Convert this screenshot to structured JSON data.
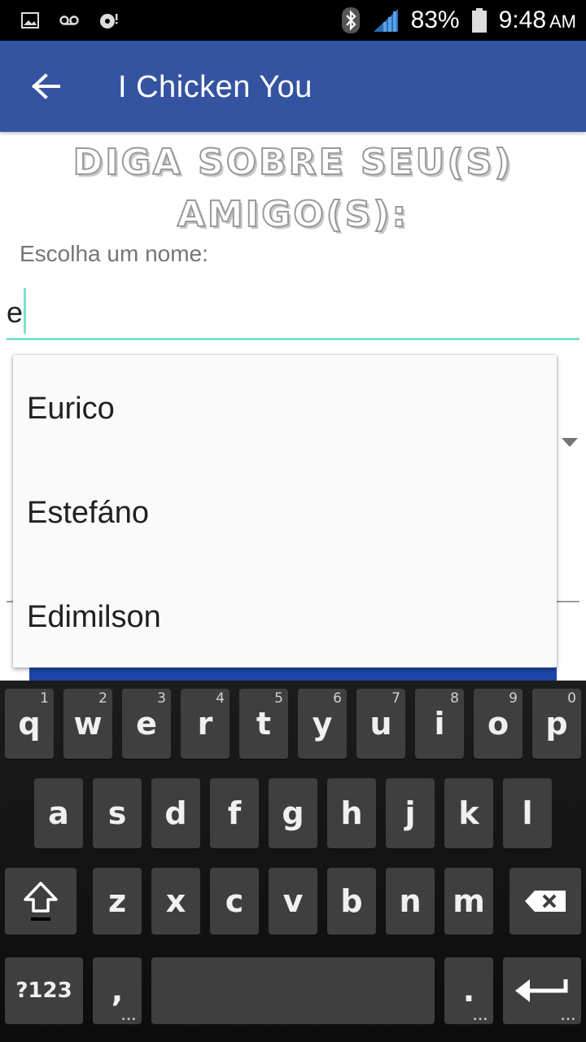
{
  "status_bar": {
    "battery": "83%",
    "time": "9:48",
    "time_suffix": "AM",
    "icons": [
      "image-icon",
      "voicemail-icon",
      "media-icon",
      "bluetooth-icon",
      "signal-icon",
      "battery-icon"
    ]
  },
  "app_bar": {
    "title": "I Chicken You",
    "back_icon": "arrow-left-icon",
    "color": "#3454a2"
  },
  "form": {
    "heading": "Diga sobre seu(s) amigo(s):",
    "name_label": "Escolha um nome:",
    "name_value": "e",
    "accent_color": "#80e0cf"
  },
  "suggestions": [
    "Eurico",
    "Estefáno",
    "Edimilson"
  ],
  "keyboard": {
    "row1": [
      {
        "label": "q",
        "hint": "1"
      },
      {
        "label": "w",
        "hint": "2"
      },
      {
        "label": "e",
        "hint": "3"
      },
      {
        "label": "r",
        "hint": "4"
      },
      {
        "label": "t",
        "hint": "5"
      },
      {
        "label": "y",
        "hint": "6"
      },
      {
        "label": "u",
        "hint": "7"
      },
      {
        "label": "i",
        "hint": "8"
      },
      {
        "label": "o",
        "hint": "9"
      },
      {
        "label": "p",
        "hint": "0"
      }
    ],
    "row2": [
      "a",
      "s",
      "d",
      "f",
      "g",
      "h",
      "j",
      "k",
      "l"
    ],
    "row3": [
      "z",
      "x",
      "c",
      "v",
      "b",
      "n",
      "m"
    ],
    "symbols_label": "?123",
    "comma_label": ",",
    "period_label": ".",
    "shift_icon": "shift-icon",
    "backspace_icon": "backspace-icon",
    "enter_icon": "enter-icon"
  }
}
